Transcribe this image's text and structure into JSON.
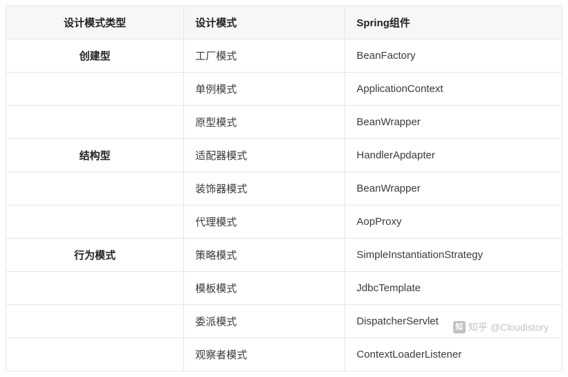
{
  "headers": {
    "col1": "设计模式类型",
    "col2": "设计模式",
    "col3": "Spring组件"
  },
  "rows": [
    {
      "type": "创建型",
      "pattern": "工厂模式",
      "component": "BeanFactory"
    },
    {
      "type": "",
      "pattern": "单例模式",
      "component": "ApplicationContext"
    },
    {
      "type": "",
      "pattern": "原型模式",
      "component": "BeanWrapper"
    },
    {
      "type": "结构型",
      "pattern": "适配器模式",
      "component": "HandlerApdapter"
    },
    {
      "type": "",
      "pattern": "装饰器模式",
      "component": "BeanWrapper"
    },
    {
      "type": "",
      "pattern": "代理模式",
      "component": "AopProxy"
    },
    {
      "type": "行为模式",
      "pattern": "策略模式",
      "component": "SimpleInstantiationStrategy"
    },
    {
      "type": "",
      "pattern": "模板模式",
      "component": "JdbcTemplate"
    },
    {
      "type": "",
      "pattern": "委派模式",
      "component": "DispatcherServlet"
    },
    {
      "type": "",
      "pattern": "观察者模式",
      "component": "ContextLoaderListener"
    }
  ],
  "watermark": {
    "brand": "知乎",
    "logo": "知",
    "author": "@Cloudistory"
  }
}
